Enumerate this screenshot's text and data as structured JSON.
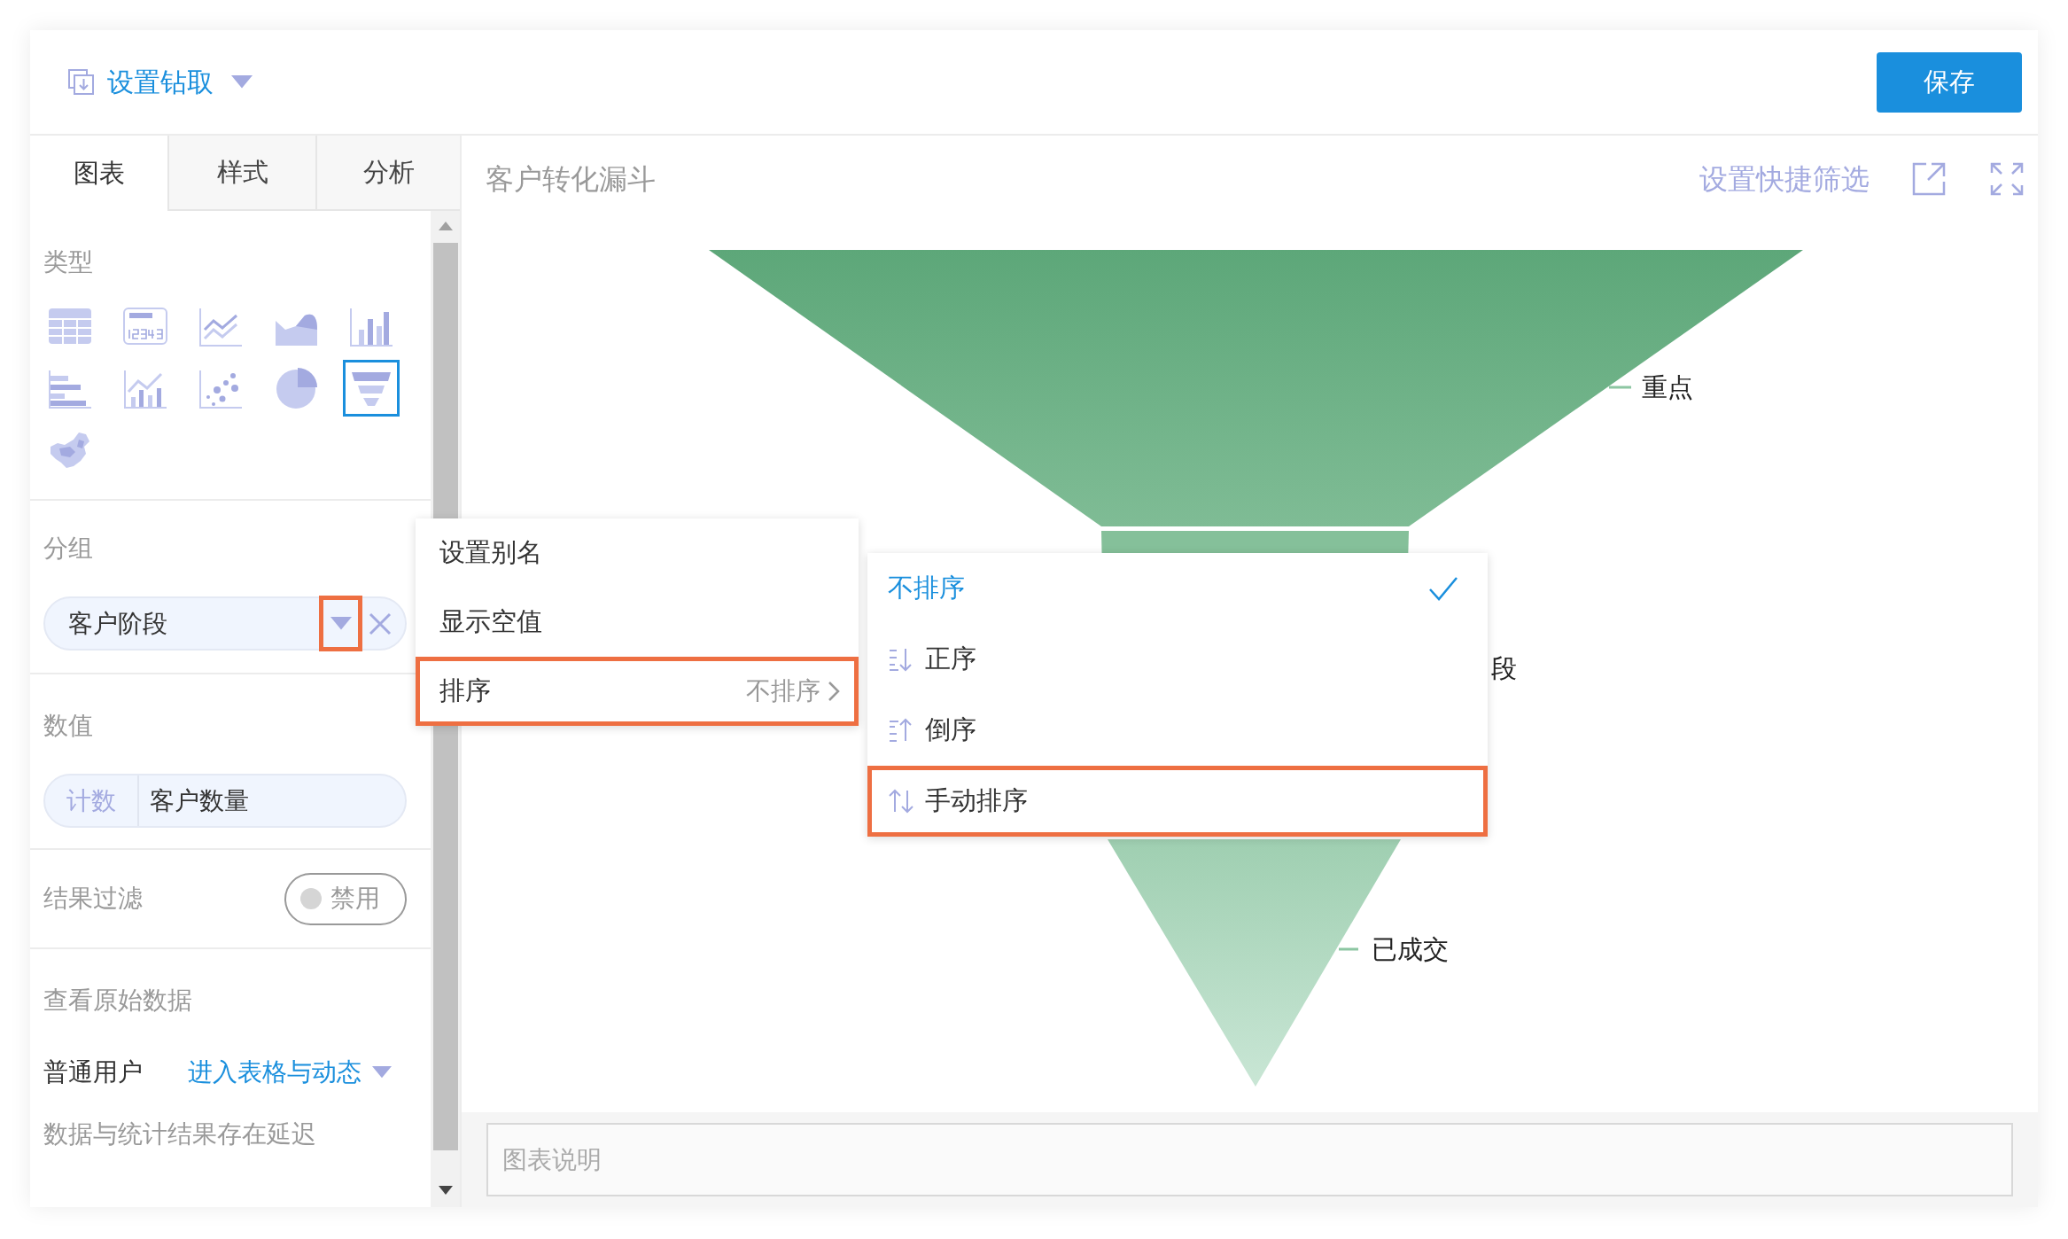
{
  "header": {
    "title": "设置钻取",
    "save_button": "保存"
  },
  "tabs": [
    {
      "label": "图表",
      "selected": true
    },
    {
      "label": "样式",
      "selected": false
    },
    {
      "label": "分析",
      "selected": false
    }
  ],
  "type_section": {
    "label": "类型",
    "chart_types": [
      {
        "kind": "table",
        "selected": false
      },
      {
        "kind": "number",
        "selected": false
      },
      {
        "kind": "line",
        "selected": false
      },
      {
        "kind": "area",
        "selected": false
      },
      {
        "kind": "bar",
        "selected": false
      },
      {
        "kind": "hbar",
        "selected": false
      },
      {
        "kind": "combo",
        "selected": false
      },
      {
        "kind": "scatter",
        "selected": false
      },
      {
        "kind": "pie",
        "selected": false
      },
      {
        "kind": "funnel",
        "selected": true
      },
      {
        "kind": "map",
        "selected": false
      }
    ]
  },
  "group_section": {
    "label": "分组",
    "field": {
      "value": "客户阶段",
      "caret_highlighted": true
    }
  },
  "value_section": {
    "label": "数值",
    "field": {
      "aggregate": "计数",
      "value": "客户数量"
    }
  },
  "filter_section": {
    "label": "结果过滤",
    "toggle": {
      "label": "禁用",
      "on": false
    }
  },
  "raw_data_section": {
    "label": "查看原始数据",
    "rows": [
      {
        "role": "普通用户",
        "link": "进入表格与动态"
      }
    ],
    "note": "数据与统计结果存在延迟"
  },
  "chart": {
    "title": "客户转化漏斗",
    "quick_filter": "设置快捷筛选",
    "labels": [
      {
        "text": "重点",
        "leader": true
      },
      {
        "text": "段"
      },
      {
        "text": "已成交",
        "leader": true
      }
    ],
    "description_placeholder": "图表说明"
  },
  "context_menu": {
    "items": [
      {
        "label": "设置别名",
        "highlighted": false
      },
      {
        "label": "显示空值",
        "highlighted": false
      },
      {
        "label": "排序",
        "value": "不排序",
        "highlighted": true
      }
    ]
  },
  "sort_submenu": {
    "items": [
      {
        "kind": "none",
        "label": "不排序",
        "selected": true,
        "highlighted": false
      },
      {
        "kind": "asc",
        "label": "正序",
        "selected": false,
        "highlighted": false
      },
      {
        "kind": "desc",
        "label": "倒序",
        "selected": false,
        "highlighted": false
      },
      {
        "kind": "manual",
        "label": "手动排序",
        "selected": false,
        "highlighted": true
      }
    ]
  }
}
